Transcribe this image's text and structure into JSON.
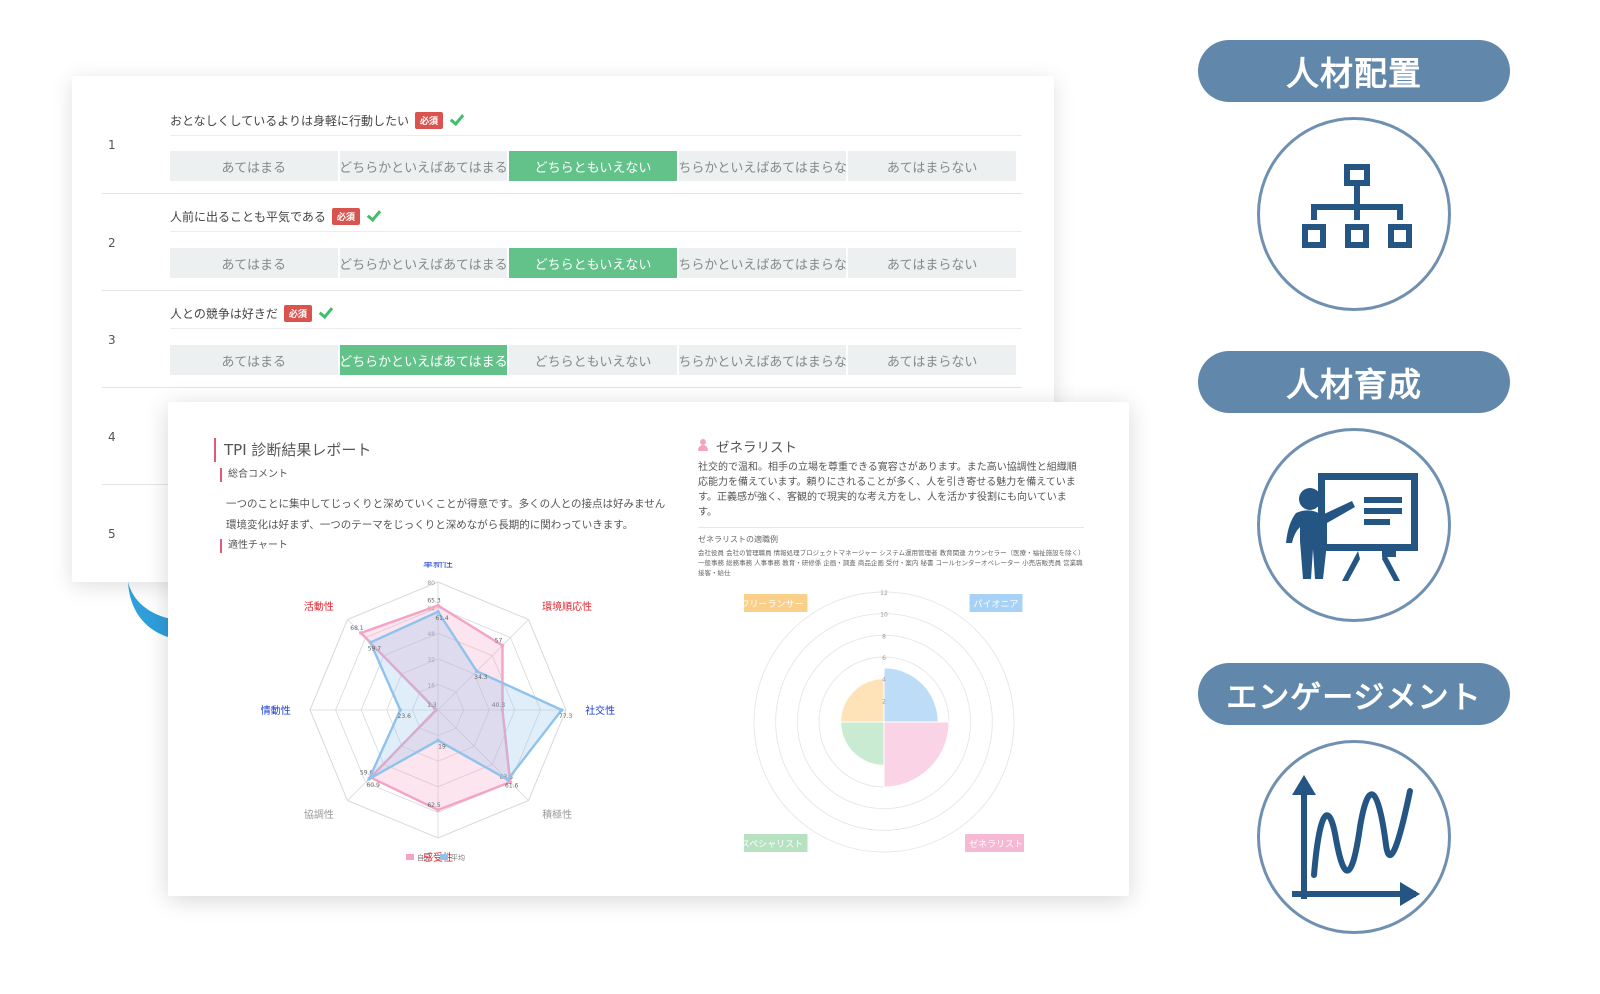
{
  "survey": {
    "required_label": "必須",
    "questions": [
      {
        "num": "1",
        "text": "おとなしくしているよりは身軽に行動したい",
        "answered": true,
        "selected": 2
      },
      {
        "num": "2",
        "text": "人前に出ることも平気である",
        "answered": true,
        "selected": 2
      },
      {
        "num": "3",
        "text": "人との競争は好きだ",
        "answered": true,
        "selected": 1
      },
      {
        "num": "4",
        "text": "",
        "answered": false,
        "selected": null
      },
      {
        "num": "5",
        "text": "",
        "answered": false,
        "selected": null
      }
    ],
    "options": [
      "あてはまる",
      "どちらかといえばあてはまる",
      "どちらともいえない",
      "どちらかといえばあてはまらない",
      "あてはまらない"
    ]
  },
  "report": {
    "title": "TPI 診断結果レポート",
    "comment_heading": "総合コメント",
    "comment_lines": [
      "一つのことに集中してじっくりと深めていくことが得意です。多くの人との接点は好みません",
      "環境変化は好まず、一つのテーマをじっくりと深めながら長期的に関わっていきます。"
    ],
    "chart_heading": "適性チャート",
    "type_name": "ゼネラリスト",
    "type_description": "社交的で温和。相手の立場を尊重できる寛容さがあります。また高い協調性と組織順応能力を備えています。頼りにされることが多く、人を引き寄せる魅力を備えています。正義感が強く、客観的で現実的な考え方をし、人を活かす役割にも向いています。",
    "jobs_title": "ゼネラリストの適職例",
    "jobs_text": "会社役員 会社の管理職員 情報処理プロジェクトマネージャー システム運用管理者 教育関連 カウンセラー（医療・福祉施設を除く）一般事務 総務事務 人事事務 教育・研修係 企画・調査 商品企画 受付・案内 秘書 コールセンターオペレーター 小売店販売員 営業職 接客・給仕"
  },
  "chart_data": [
    {
      "type": "radar",
      "title": "",
      "axes": [
        "革新性",
        "環境順応性",
        "社交性",
        "積極性",
        "感受性",
        "協調性",
        "情動性",
        "活動性"
      ],
      "axis_colors": [
        "#1a3cd6",
        "#e0222e",
        "#1a3cd6",
        "#999999",
        "#e0222e",
        "#999999",
        "#1a3cd6",
        "#e0222e"
      ],
      "rlim": [
        0,
        80
      ],
      "ticks": [
        16,
        32,
        48,
        64,
        80
      ],
      "series": [
        {
          "name": "自分",
          "color": "#f4a3c4",
          "values": [
            65.3,
            57,
            40.3,
            63.8,
            62.5,
            59.6,
            1.3,
            68.1
          ]
        },
        {
          "name": "平均",
          "color": "#8fc3ec",
          "values": [
            61.4,
            34.3,
            77.3,
            61.6,
            19,
            60.9,
            23.6,
            59.7
          ]
        }
      ],
      "legend": [
        "自分",
        "平均"
      ],
      "legend_position": "bottom"
    },
    {
      "type": "polar-area",
      "title": "",
      "categories": [
        "パイオニア",
        "ゼネラリスト",
        "スペシャリスト",
        "フリーランサー"
      ],
      "colors": [
        "#bddcf7",
        "#fbd3e6",
        "#c9ebd2",
        "#fde3b7"
      ],
      "label_colors": [
        "#a7d1f5",
        "#f7b8d3",
        "#b6e2c2",
        "#f9cf8a"
      ],
      "values": [
        5,
        6,
        4,
        4
      ],
      "rlim": [
        0,
        12
      ],
      "ticks": [
        2,
        4,
        6,
        8,
        10,
        12
      ]
    }
  ],
  "right_panel": {
    "items": [
      {
        "label": "人材配置",
        "icon": "org-chart-icon"
      },
      {
        "label": "人材育成",
        "icon": "presentation-icon"
      },
      {
        "label": "エンゲージメント",
        "icon": "line-graph-icon"
      }
    ],
    "accent": "#6188ab",
    "icon_color": "#245583"
  }
}
